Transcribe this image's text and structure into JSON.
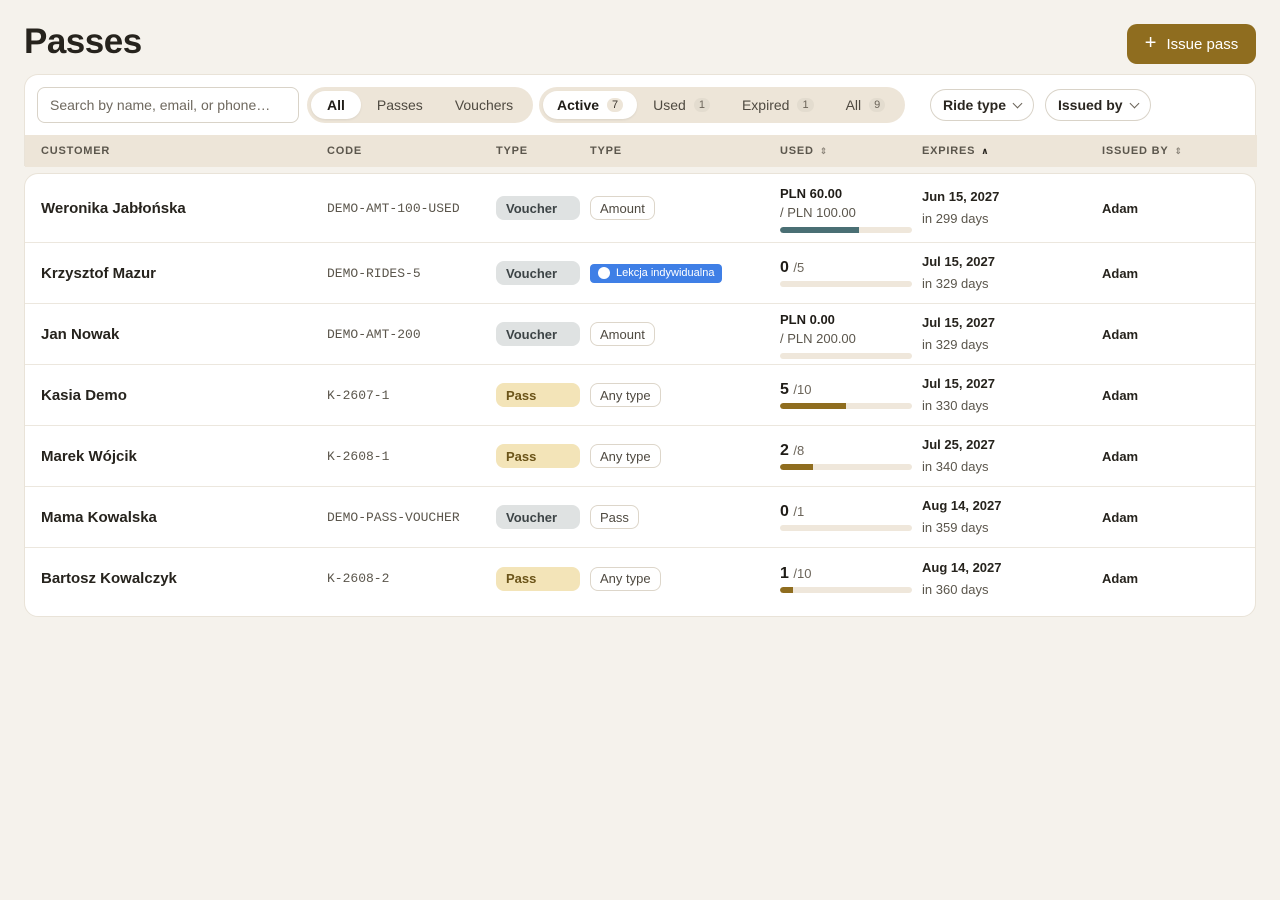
{
  "header": {
    "title": "Passes",
    "issue_button_label": "Issue pass"
  },
  "toolbar": {
    "search_placeholder": "Search by name, email, or phone…",
    "kind_tabs": [
      {
        "label": "All",
        "active": true
      },
      {
        "label": "Passes",
        "active": false
      },
      {
        "label": "Vouchers",
        "active": false
      }
    ],
    "status_tabs": [
      {
        "label": "Active",
        "count": "7",
        "active": true
      },
      {
        "label": "Used",
        "count": "1",
        "active": false
      },
      {
        "label": "Expired",
        "count": "1",
        "active": false
      },
      {
        "label": "All",
        "count": "9",
        "active": false
      }
    ],
    "ride_type_label": "Ride type",
    "issued_by_label": "Issued by"
  },
  "columns": {
    "customer": "CUSTOMER",
    "code": "CODE",
    "type": "TYPE",
    "subtype": "TYPE",
    "used": "USED",
    "expires": "EXPIRES",
    "issued_by": "ISSUED BY"
  },
  "colors": {
    "accent": "#8f6d1f",
    "voucher_bar": "#4a6f74",
    "pass_bar": "#8f6d1f",
    "ride_badge": "#3f7fe6"
  },
  "rows": [
    {
      "customer": "Weronika Jabłońska",
      "code": "DEMO-AMT-100-USED",
      "type": "Voucher",
      "subtype": "Amount",
      "subtype_kind": "plain",
      "usage_kind": "amount",
      "used_amount": "PLN 60.00",
      "total_amount": "/ PLN 100.00",
      "progress": 0.6,
      "expires_date": "Jun 15, 2027",
      "expires_rel": "in 299 days",
      "issued_by": "Adam"
    },
    {
      "customer": "Krzysztof Mazur",
      "code": "DEMO-RIDES-5",
      "type": "Voucher",
      "subtype": "Lekcja indywidualna",
      "subtype_kind": "ride",
      "usage_kind": "count",
      "used": "0",
      "total": "/5",
      "progress": 0,
      "expires_date": "Jul 15, 2027",
      "expires_rel": "in 329 days",
      "issued_by": "Adam"
    },
    {
      "customer": "Jan Nowak",
      "code": "DEMO-AMT-200",
      "type": "Voucher",
      "subtype": "Amount",
      "subtype_kind": "plain",
      "usage_kind": "amount",
      "used_amount": "PLN 0.00",
      "total_amount": "/ PLN 200.00",
      "progress": 0,
      "expires_date": "Jul 15, 2027",
      "expires_rel": "in 329 days",
      "issued_by": "Adam"
    },
    {
      "customer": "Kasia Demo",
      "code": "K-2607-1",
      "type": "Pass",
      "subtype": "Any type",
      "subtype_kind": "plain",
      "usage_kind": "count",
      "used": "5",
      "total": "/10",
      "progress": 0.5,
      "expires_date": "Jul 15, 2027",
      "expires_rel": "in 330 days",
      "issued_by": "Adam"
    },
    {
      "customer": "Marek Wójcik",
      "code": "K-2608-1",
      "type": "Pass",
      "subtype": "Any type",
      "subtype_kind": "plain",
      "usage_kind": "count",
      "used": "2",
      "total": "/8",
      "progress": 0.25,
      "expires_date": "Jul 25, 2027",
      "expires_rel": "in 340 days",
      "issued_by": "Adam"
    },
    {
      "customer": "Mama Kowalska",
      "code": "DEMO-PASS-VOUCHER",
      "type": "Voucher",
      "subtype": "Pass",
      "subtype_kind": "plain",
      "usage_kind": "count",
      "used": "0",
      "total": "/1",
      "progress": 0,
      "expires_date": "Aug 14, 2027",
      "expires_rel": "in 359 days",
      "issued_by": "Adam"
    },
    {
      "customer": "Bartosz Kowalczyk",
      "code": "K-2608-2",
      "type": "Pass",
      "subtype": "Any type",
      "subtype_kind": "plain",
      "usage_kind": "count",
      "used": "1",
      "total": "/10",
      "progress": 0.1,
      "expires_date": "Aug 14, 2027",
      "expires_rel": "in 360 days",
      "issued_by": "Adam"
    }
  ]
}
